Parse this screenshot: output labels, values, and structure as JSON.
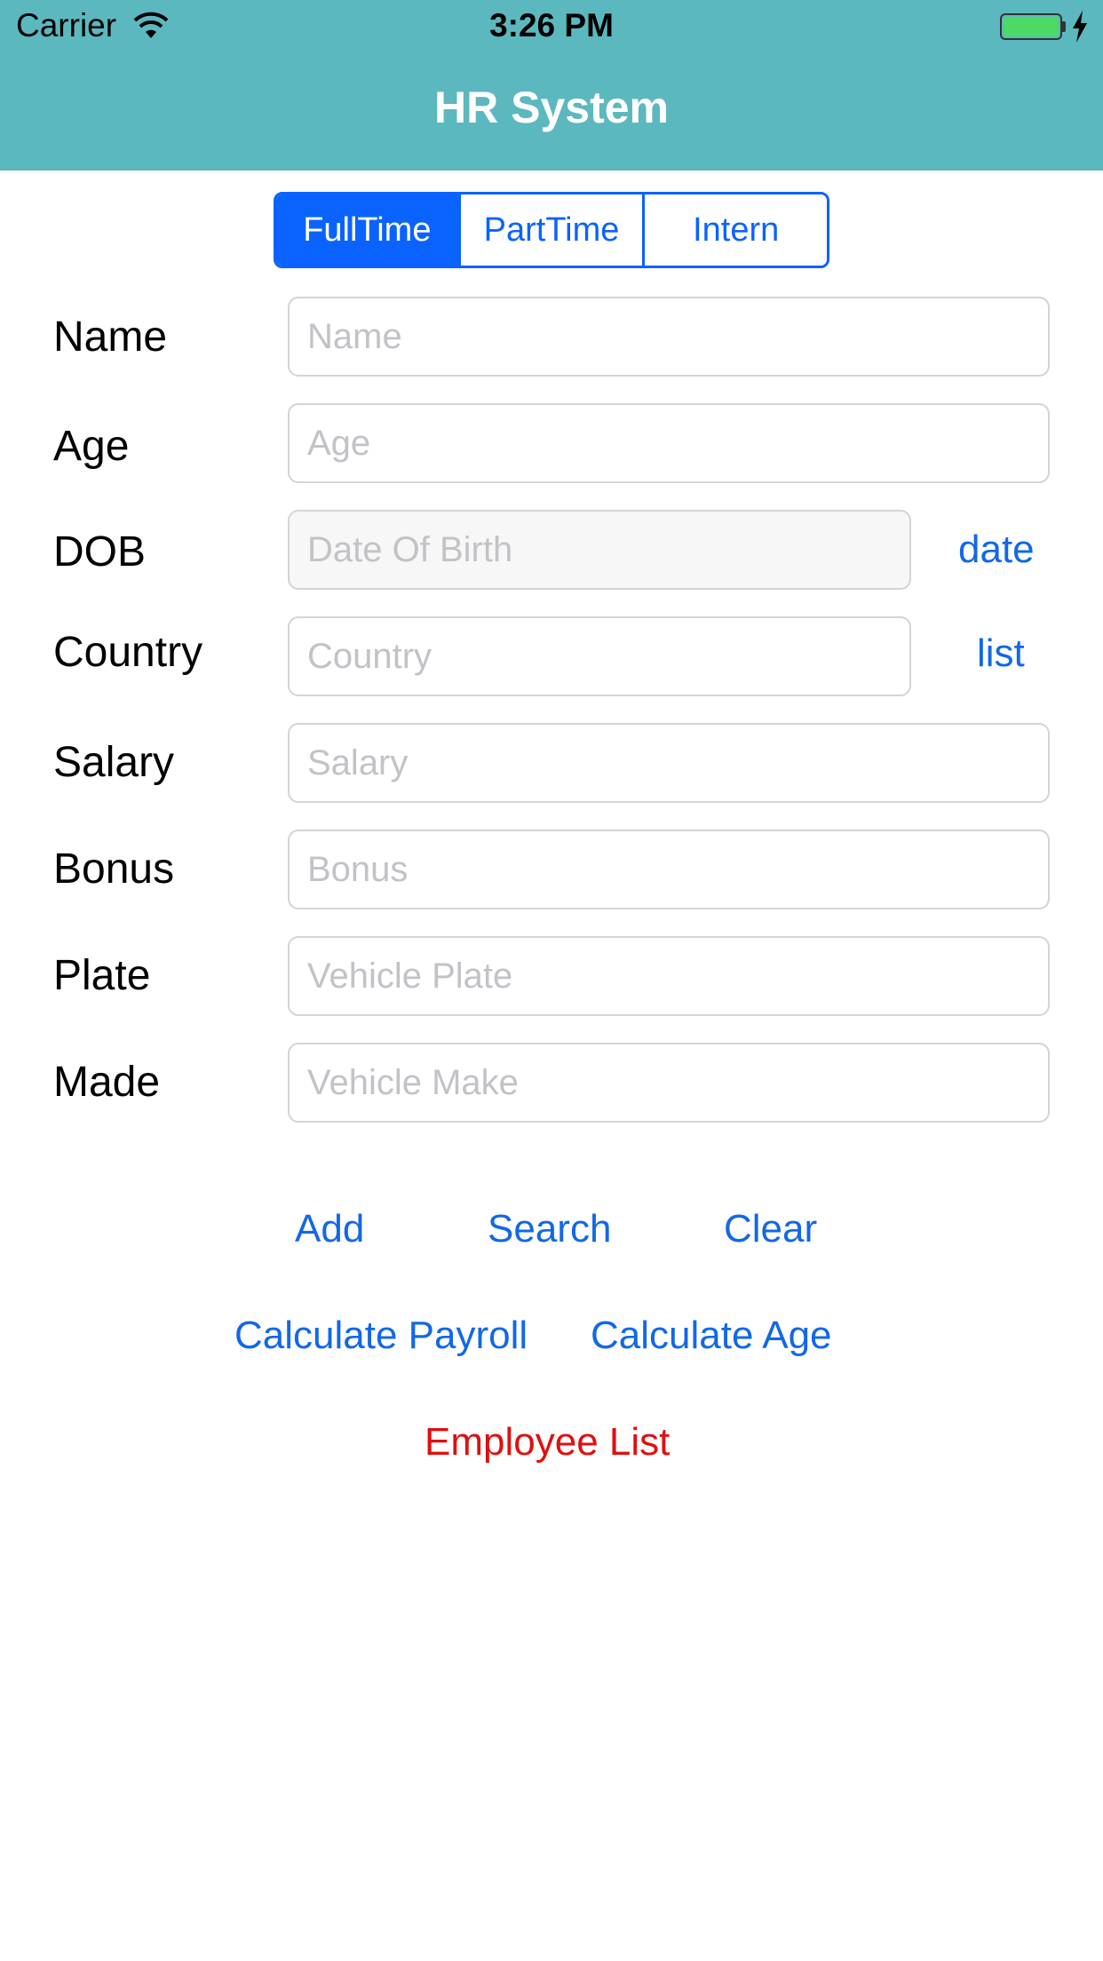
{
  "status_bar": {
    "carrier": "Carrier",
    "time": "3:26 PM",
    "icons": [
      "wifi-icon",
      "battery-icon",
      "charging-bolt-icon"
    ]
  },
  "nav": {
    "title": "HR System",
    "background": "#5cb8bf"
  },
  "segments": {
    "items": [
      "FullTime",
      "PartTime",
      "Intern"
    ],
    "selected": "FullTime",
    "accent": "#0a63ff"
  },
  "form": {
    "name": {
      "label": "Name",
      "placeholder": "Name",
      "value": ""
    },
    "age": {
      "label": "Age",
      "placeholder": "Age",
      "value": ""
    },
    "dob": {
      "label": "DOB",
      "placeholder": "Date Of Birth",
      "value": "",
      "action": "date"
    },
    "country": {
      "label": "Country",
      "placeholder": "Country",
      "value": "",
      "action": "list"
    },
    "salary": {
      "label": "Salary",
      "placeholder": "Salary",
      "value": ""
    },
    "bonus": {
      "label": "Bonus",
      "placeholder": "Bonus",
      "value": ""
    },
    "plate": {
      "label": "Plate",
      "placeholder": "Vehicle Plate",
      "value": ""
    },
    "made": {
      "label": "Made",
      "placeholder": "Vehicle Make",
      "value": ""
    }
  },
  "actions": {
    "add": "Add",
    "search": "Search",
    "clear": "Clear",
    "calculate_payroll": "Calculate Payroll",
    "calculate_age": "Calculate Age",
    "employee_list": "Employee List"
  },
  "colors": {
    "link": "#1268e6",
    "danger": "#e00f0f"
  }
}
